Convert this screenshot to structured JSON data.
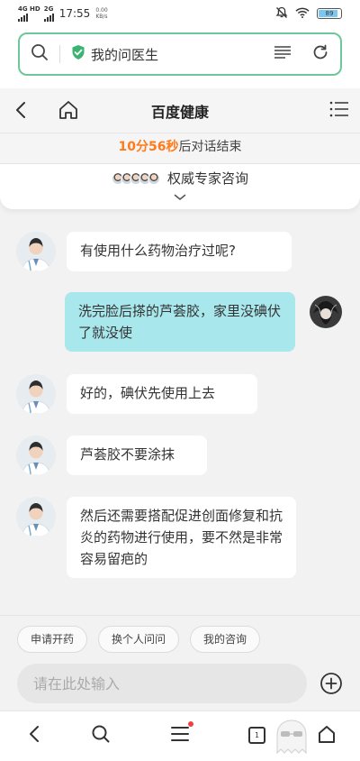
{
  "status_bar": {
    "network_1": "4G HD",
    "network_2": "2G",
    "time": "17:55",
    "speed_value": "0.00",
    "speed_unit": "KB/s",
    "battery": "89",
    "battery_level": 0.89
  },
  "browser": {
    "search_text": "我的问医生"
  },
  "header": {
    "title": "百度健康"
  },
  "timer": {
    "countdown": "10分56秒",
    "suffix": "后对话结束"
  },
  "expert": {
    "title": "权威专家咨询"
  },
  "messages": [
    {
      "sender": "doctor",
      "text": "有使用什么药物治疗过呢?"
    },
    {
      "sender": "user",
      "text": "洗完脸后搽的芦荟胶，家里没碘伏了就没使"
    },
    {
      "sender": "doctor",
      "text": "好的，碘伏先使用上去"
    },
    {
      "sender": "doctor",
      "text": "芦荟胶不要涂抹"
    },
    {
      "sender": "doctor",
      "text": "然后还需要搭配促进创面修复和抗炎的药物进行使用，要不然是非常容易留疤的"
    }
  ],
  "quick_actions": [
    "申请开药",
    "换个人问问",
    "我的咨询"
  ],
  "input": {
    "placeholder": "请在此处输入"
  },
  "nav": {
    "tab_count": "1"
  },
  "colors": {
    "accent_green": "#6cc89a",
    "countdown_orange": "#ff7a1a",
    "user_bubble": "#a8e7ec",
    "doctor_bubble": "#ffffff",
    "notification_red": "#f04040"
  }
}
